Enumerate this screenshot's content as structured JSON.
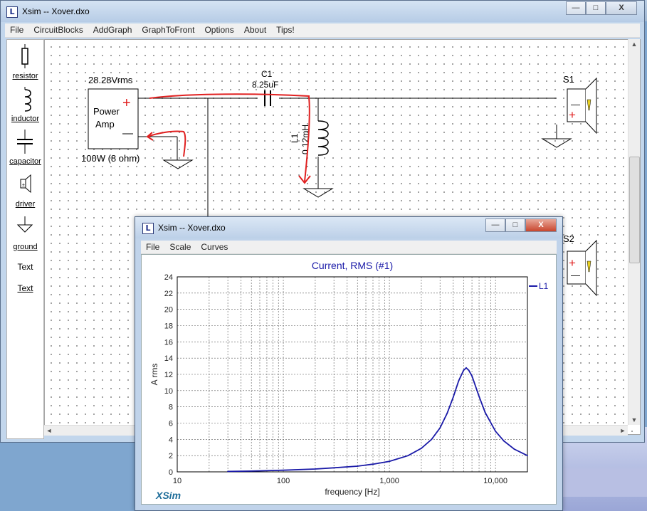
{
  "main_window": {
    "title": "Xsim -- Xover.dxo",
    "caption_buttons": [
      "—",
      "□",
      "X"
    ],
    "menu": [
      "File",
      "CircuitBlocks",
      "AddGraph",
      "GraphToFront",
      "Options",
      "About",
      "Tips!"
    ]
  },
  "palette": [
    {
      "label": "resistor",
      "icon": "resistor-icon"
    },
    {
      "label": "inductor",
      "icon": "inductor-icon"
    },
    {
      "label": "capacitor",
      "icon": "capacitor-icon"
    },
    {
      "label": "driver",
      "icon": "driver-icon"
    },
    {
      "label": "ground",
      "icon": "ground-icon"
    },
    {
      "label": "Text",
      "icon": ""
    },
    {
      "label": "Text",
      "icon": ""
    }
  ],
  "schematic": {
    "source_voltage": "28.28Vrms",
    "amp_label_1": "Power",
    "amp_label_2": "Amp",
    "amp_plus": "+",
    "amp_minus": "—",
    "amp_rating": "100W (8 ohm)",
    "cap_name": "C1",
    "cap_value": "8.25uF",
    "ind_name": "L1",
    "ind_value": "0.12mH",
    "speaker1": "S1",
    "speaker2": "S2",
    "annotation_color": "#e02020"
  },
  "graph_window": {
    "title": "Xsim -- Xover.dxo",
    "caption_buttons": [
      "—",
      "□",
      "X"
    ],
    "menu": [
      "File",
      "Scale",
      "Curves"
    ],
    "brand": "XSim"
  },
  "chart_data": {
    "type": "line",
    "title": "Current, RMS (#1)",
    "xlabel": "frequency [Hz]",
    "ylabel": "A rms",
    "xscale": "log",
    "xlim": [
      10,
      20000
    ],
    "ylim": [
      0,
      24
    ],
    "x_ticks": [
      "10",
      "100",
      "1,000",
      "10,000"
    ],
    "y_ticks": [
      "0",
      "2",
      "4",
      "6",
      "8",
      "10",
      "12",
      "14",
      "16",
      "18",
      "20",
      "22",
      "24"
    ],
    "grid": true,
    "legend_position": "top-right",
    "color": "#1a1aa8",
    "series": [
      {
        "name": "L1",
        "x": [
          30,
          50,
          100,
          200,
          300,
          500,
          700,
          1000,
          1500,
          2000,
          2500,
          3000,
          3500,
          4000,
          4500,
          5000,
          5300,
          5600,
          6000,
          7000,
          8000,
          10000,
          12000,
          15000,
          20000
        ],
        "y": [
          0.05,
          0.1,
          0.2,
          0.35,
          0.5,
          0.7,
          0.95,
          1.3,
          2.0,
          2.9,
          4.0,
          5.4,
          7.2,
          9.2,
          11.2,
          12.5,
          12.8,
          12.5,
          11.8,
          9.3,
          7.3,
          5.0,
          3.8,
          2.8,
          2.0
        ]
      }
    ]
  }
}
